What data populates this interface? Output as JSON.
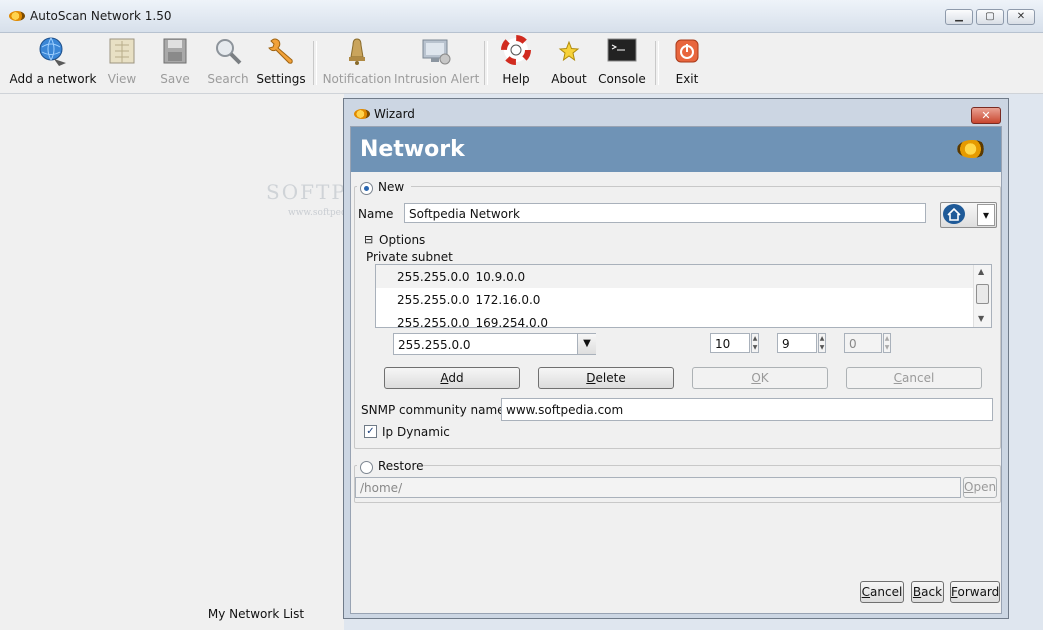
{
  "window": {
    "title": "AutoScan Network 1.50",
    "minimize_glyph": "▁",
    "maximize_glyph": "▢",
    "close_glyph": "✕"
  },
  "toolbar": {
    "items": [
      {
        "label": "Add a network",
        "icon": "globe-add-icon",
        "enabled": true
      },
      {
        "label": "View",
        "icon": "view-icon",
        "enabled": false
      },
      {
        "label": "Save",
        "icon": "floppy-disk-icon",
        "enabled": false
      },
      {
        "label": "Search",
        "icon": "magnifier-icon",
        "enabled": false
      },
      {
        "label": "Settings",
        "icon": "wrench-icon",
        "enabled": true
      },
      {
        "label": "Notification",
        "icon": "bell-icon",
        "enabled": false
      },
      {
        "label": "Intrusion Alert",
        "icon": "monitor-alert-icon",
        "enabled": false
      },
      {
        "label": "Help",
        "icon": "lifebuoy-icon",
        "enabled": true
      },
      {
        "label": "About",
        "icon": "star-icon",
        "enabled": true
      },
      {
        "label": "Console",
        "icon": "terminal-icon",
        "enabled": true
      },
      {
        "label": "Exit",
        "icon": "power-icon",
        "enabled": true
      }
    ]
  },
  "watermark": {
    "main": "SOFTPEDIA",
    "sub": "www.softpedia.com"
  },
  "left_pane": {
    "footer": "My Network List"
  },
  "wizard": {
    "title": "Wizard",
    "close_glyph": "✕",
    "banner_title": "Network",
    "new_label": "New",
    "name_label": "Name",
    "name_value": "Softpedia Network",
    "dropdown_glyph": "▾",
    "options_toggle": "⊟",
    "options_label": "Options",
    "private_subnet_label": "Private subnet",
    "subnets": [
      {
        "mask": "255.255.0.0",
        "net": "10.9.0.0"
      },
      {
        "mask": "255.255.0.0",
        "net": "172.16.0.0"
      },
      {
        "mask": "255.255.0.0",
        "net": "169.254.0.0"
      }
    ],
    "mask_select": "255.255.0.0",
    "octet1": "10",
    "octet2": "9",
    "octet3": "0",
    "buttons": {
      "add": "Add",
      "delete": "Delete",
      "ok": "OK",
      "cancel": "Cancel"
    },
    "snmp_label": "SNMP community name :",
    "snmp_value": "www.softpedia.com",
    "ip_dynamic_label": "Ip Dynamic",
    "ip_dynamic_checked": true,
    "check_glyph": "✓",
    "restore_label": "Restore",
    "restore_path": "/home/",
    "open_label": "Open",
    "footer": {
      "cancel": "Cancel",
      "back": "Back",
      "forward": "Forward"
    }
  }
}
